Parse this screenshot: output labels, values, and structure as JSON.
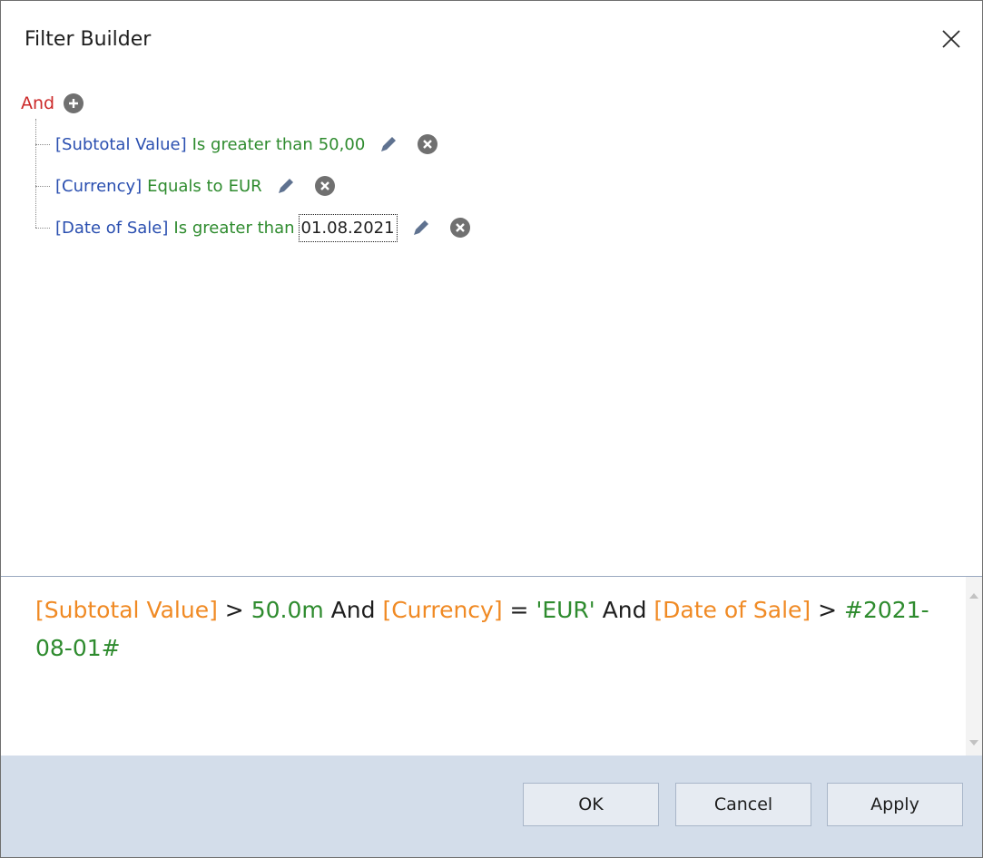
{
  "window": {
    "title": "Filter Builder"
  },
  "tree": {
    "group_operator": "And",
    "conditions": [
      {
        "field": "[Subtotal Value]",
        "operator": "Is greater than",
        "value": "50,00"
      },
      {
        "field": "[Currency]",
        "operator": "Equals to",
        "value": "EUR"
      },
      {
        "field": "[Date of Sale]",
        "operator": "Is greater than",
        "value": "01.08.2021"
      }
    ]
  },
  "expression": {
    "tokens": [
      "[Subtotal Value]",
      " > ",
      "50.0m",
      " And ",
      "[Currency]",
      " = ",
      "'EUR'",
      " And ",
      "[Date of Sale]",
      " > ",
      "#2021-08-01#"
    ]
  },
  "buttons": {
    "ok": "OK",
    "cancel": "Cancel",
    "apply": "Apply"
  },
  "colors": {
    "group_operator": "#cc2a2a",
    "field": "#2a4fb0",
    "operator_value": "#2e8b2e",
    "expr_field": "#f08a24",
    "footer": "#d3ddea"
  }
}
